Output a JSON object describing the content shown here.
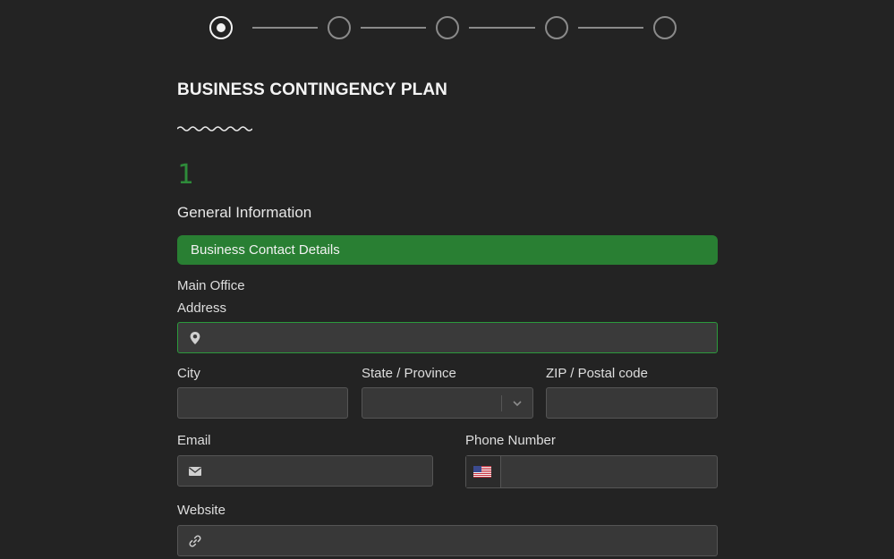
{
  "stepper": {
    "steps": [
      {
        "label": "",
        "state": "active"
      },
      {
        "label": "",
        "state": "pending"
      },
      {
        "label": "",
        "state": "pending"
      },
      {
        "label": "",
        "state": "pending"
      },
      {
        "label": "",
        "state": "pending"
      }
    ]
  },
  "form": {
    "title": "BUSINESS CONTINGENCY PLAN",
    "section_number": "1",
    "section_title": "General Information",
    "banner": "Business Contact Details",
    "group_label": "Main Office"
  },
  "fields": {
    "address": {
      "label": "Address",
      "value": "",
      "placeholder": "",
      "icon": "map-pin-icon"
    },
    "city": {
      "label": "City",
      "value": "",
      "placeholder": ""
    },
    "state": {
      "label": "State / Province",
      "value": ""
    },
    "zip": {
      "label": "ZIP / Postal code",
      "value": "",
      "placeholder": ""
    },
    "email": {
      "label": "Email",
      "value": "",
      "placeholder": "",
      "icon": "envelope-icon"
    },
    "phone": {
      "label": "Phone Number",
      "value": "",
      "placeholder": "",
      "flag": "us-flag-icon"
    },
    "website": {
      "label": "Website",
      "value": "",
      "placeholder": "",
      "icon": "link-icon"
    }
  },
  "colors": {
    "background": "#232323",
    "accent": "#297f33",
    "focus_border": "#2c9a3c",
    "section_number": "#2e8b3a"
  }
}
